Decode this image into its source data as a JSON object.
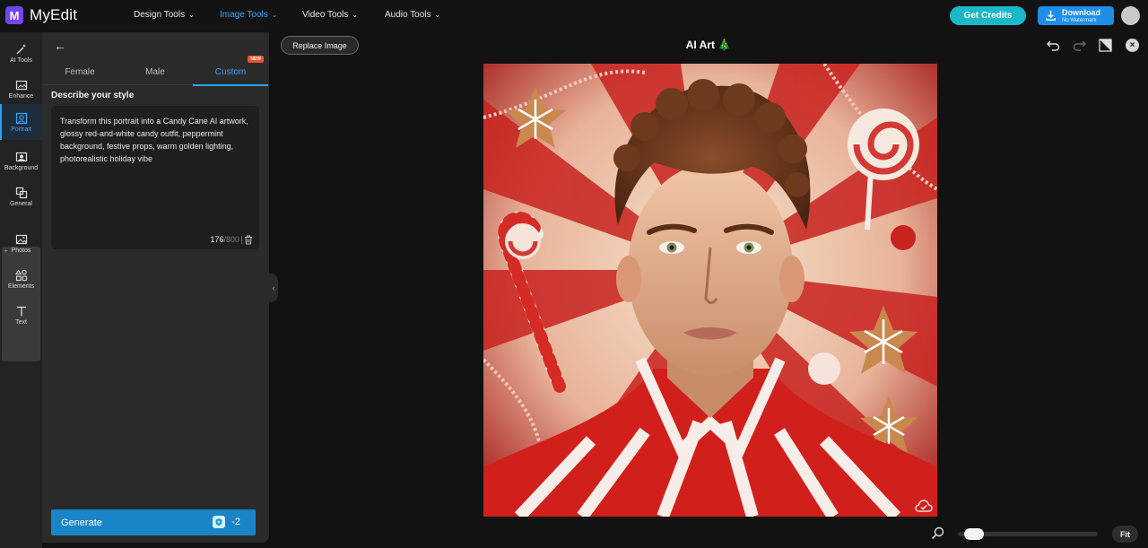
{
  "app": {
    "name": "MyEdit"
  },
  "nav": [
    {
      "label": "Design Tools",
      "active": false
    },
    {
      "label": "Image Tools",
      "active": true
    },
    {
      "label": "Video Tools",
      "active": false
    },
    {
      "label": "Audio Tools",
      "active": false
    }
  ],
  "header": {
    "credits_label": "Get Credits",
    "download_label": "Download",
    "download_sub": "No Watermark"
  },
  "rail": [
    {
      "label": "AI Tools",
      "icon": "magic-wand-icon"
    },
    {
      "label": "Enhance",
      "icon": "enhance-image-icon"
    },
    {
      "label": "Portrait",
      "icon": "portrait-icon",
      "active": true
    },
    {
      "label": "Background",
      "icon": "background-icon"
    },
    {
      "label": "General",
      "icon": "general-icon"
    },
    {
      "label": "Photos",
      "icon": "photos-icon"
    },
    {
      "label": "Elements",
      "icon": "elements-icon"
    },
    {
      "label": "Text",
      "icon": "text-icon"
    }
  ],
  "panel": {
    "tabs": [
      {
        "label": "Female"
      },
      {
        "label": "Male"
      },
      {
        "label": "Custom",
        "active": true,
        "badge": "NEW"
      }
    ],
    "section_title": "Describe your style",
    "prompt": "Transform this portrait into a Candy Cane AI artwork, glossy red-and-white candy outfit, peppermint background, festive props, warm golden lighting, photorealistic holiday vibe",
    "char_count": "176",
    "char_max": "/800",
    "generate_label": "Generate",
    "generate_cost": "-2"
  },
  "canvas": {
    "replace_label": "Replace Image",
    "title": "AI Art",
    "title_emoji": "🎄",
    "fit_label": "Fit",
    "zoom_level": 0.05
  },
  "colors": {
    "accent": "#2aa3ff",
    "credits": "#1bb8c8",
    "download": "#1d8fe8",
    "generate": "#1a84c8"
  }
}
